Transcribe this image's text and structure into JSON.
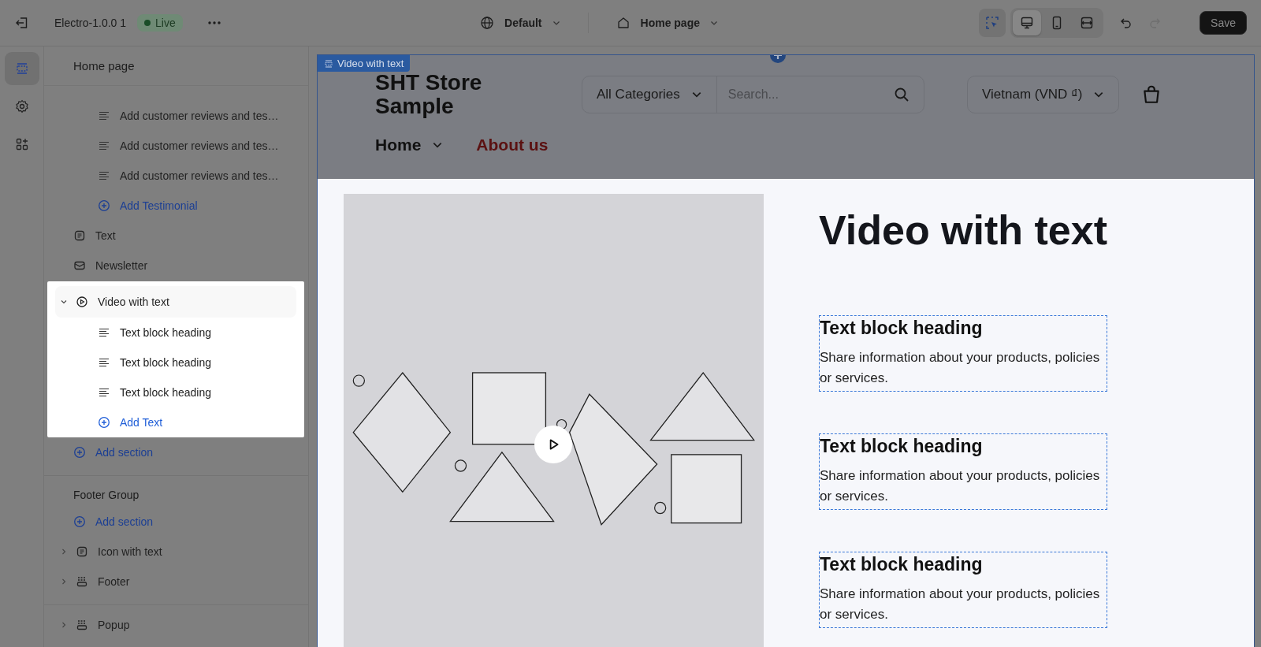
{
  "topbar": {
    "store_name": "Electro-1.0.0 1",
    "status": "Live",
    "theme": "Default",
    "page": "Home page",
    "inspect_on": true,
    "devices": [
      {
        "kind": "desktop",
        "selected": true
      },
      {
        "kind": "mobile",
        "selected": false
      },
      {
        "kind": "fullwidth",
        "selected": false
      }
    ],
    "undo_disabled": false,
    "redo_disabled": true,
    "save": "Save"
  },
  "sidebar": {
    "rail": [
      {
        "kind": "sections",
        "selected": true
      },
      {
        "kind": "settings",
        "selected": false
      },
      {
        "kind": "apps",
        "selected": false
      }
    ],
    "title": "Home page",
    "groups": [
      {
        "items": [
          {
            "kind": "block",
            "label": "Add customer reviews and tes…"
          },
          {
            "kind": "block",
            "label": "Add customer reviews and tes…"
          },
          {
            "kind": "block",
            "label": "Add customer reviews and tes…"
          },
          {
            "kind": "add-block",
            "label": "Add Testimonial"
          },
          {
            "kind": "text",
            "label": "Text",
            "selected": false
          },
          {
            "kind": "newsletter",
            "label": "Newsletter",
            "selected": false
          },
          {
            "kind": "video",
            "label": "Video with text",
            "selected": true,
            "expanded": true,
            "children": [
              {
                "kind": "block",
                "label": "Text block heading"
              },
              {
                "kind": "block",
                "label": "Text block heading"
              },
              {
                "kind": "block",
                "label": "Text block heading"
              },
              {
                "kind": "add-block",
                "label": "Add Text"
              }
            ]
          },
          {
            "kind": "add-section",
            "label": "Add section"
          }
        ]
      },
      {
        "title": "Footer Group",
        "items": [
          {
            "kind": "add-section",
            "label": "Add section"
          },
          {
            "kind": "text",
            "label": "Icon with text",
            "selected": false,
            "expanded": false
          },
          {
            "kind": "footer",
            "label": "Footer",
            "selected": false,
            "expanded": false
          }
        ]
      },
      {
        "items": [
          {
            "kind": "footer",
            "label": "Popup",
            "selected": false,
            "expanded": false
          }
        ]
      }
    ]
  },
  "preview": {
    "section_tag": "Video with text",
    "store": {
      "logo": "SHT Store Sample",
      "category": "All Categories",
      "search_placeholder": "Search...",
      "currency": "Vietnam (VND ₫)",
      "nav": [
        {
          "label": "Home",
          "kind": "menu",
          "selected": false
        },
        {
          "label": "About us",
          "kind": "link",
          "selected": true
        }
      ]
    },
    "section": {
      "heading": "Video with text",
      "blocks": [
        {
          "heading": "Text block heading",
          "text": "Share information about your products, policies or services."
        },
        {
          "heading": "Text block heading",
          "text": "Share information about your products, policies or services."
        },
        {
          "heading": "Text block heading",
          "text": "Share information about your products, policies or services."
        }
      ]
    }
  }
}
